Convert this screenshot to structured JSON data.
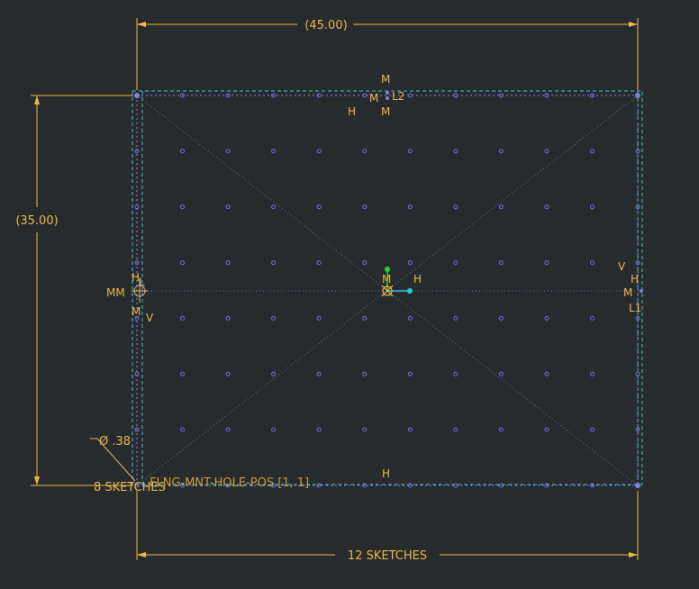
{
  "colors": {
    "background": "#282b2e",
    "dimension": "#e8b84a",
    "constraint": "#e8b84a",
    "sketch_edge": "#8080e0",
    "construction": "#3fc2c2",
    "origin_axis_y": "#30d030",
    "origin_axis_x": "#30c8d8",
    "label_text": "#c89a40"
  },
  "dimensions": {
    "width": "(45.00)",
    "height": "(35.00)",
    "pattern_count": "12 SKETCHES",
    "row_count": "8 SKETCHES",
    "hole_diameter": "Ø .38"
  },
  "labels": {
    "hole_pattern_name": "FLNG-MNT-HOLE-POS [1, 1]"
  },
  "constraints": {
    "top_mid": [
      "M",
      "M",
      "L2",
      "H",
      "M"
    ],
    "center": [
      "M",
      "H"
    ],
    "left_mid": [
      "MM",
      "H",
      "L",
      "M",
      "V"
    ],
    "right_mid": [
      "V",
      "H",
      "M",
      "L1"
    ],
    "bottom_mid": [
      "H"
    ]
  },
  "grid_dots": {
    "columns_x_mm": [
      0,
      4.09,
      8.18,
      12.27,
      16.36,
      20.45,
      24.55,
      28.64,
      32.73,
      36.82,
      40.91,
      45
    ],
    "rows_y_mm": [
      0,
      5,
      10,
      15,
      20,
      25,
      30,
      35
    ]
  }
}
